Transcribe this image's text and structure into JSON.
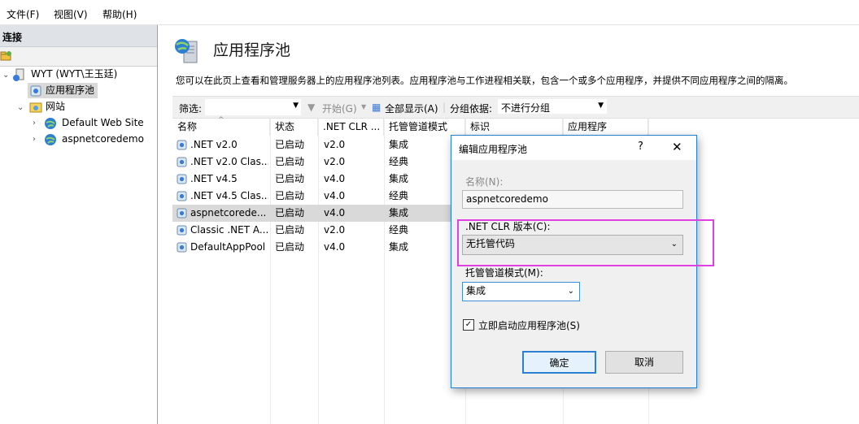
{
  "menu": [
    "文件(F)",
    "视图(V)",
    "帮助(H)"
  ],
  "connections": {
    "header": "连接",
    "tree": {
      "server": "WYT (WYT\\王玉廷)",
      "app_pools": "应用程序池",
      "sites": "网站",
      "site_items": [
        "Default Web Site",
        "aspnetcoredemo"
      ]
    }
  },
  "page": {
    "title": "应用程序池",
    "description": "您可以在此页上查看和管理服务器上的应用程序池列表。应用程序池与工作进程相关联，包含一个或多个应用程序，并提供不同应用程序之间的隔离。"
  },
  "filter_bar": {
    "filter_label": "筛选:",
    "filter_value": "",
    "start_label": "开始(G)",
    "show_all_label": "全部显示(A)",
    "group_label": "分组依据:",
    "group_value": "不进行分组"
  },
  "table": {
    "columns": [
      "名称",
      "状态",
      ".NET CLR ...",
      "托管管道模式",
      "标识",
      "应用程序"
    ],
    "rows": [
      {
        "name": ".NET v2.0",
        "status": "已启动",
        "clr": "v2.0",
        "pipeline": "集成"
      },
      {
        "name": ".NET v2.0 Clas...",
        "status": "已启动",
        "clr": "v2.0",
        "pipeline": "经典"
      },
      {
        "name": ".NET v4.5",
        "status": "已启动",
        "clr": "v4.0",
        "pipeline": "集成"
      },
      {
        "name": ".NET v4.5 Clas...",
        "status": "已启动",
        "clr": "v4.0",
        "pipeline": "经典"
      },
      {
        "name": "aspnetcorede...",
        "status": "已启动",
        "clr": "v4.0",
        "pipeline": "集成"
      },
      {
        "name": "Classic .NET A...",
        "status": "已启动",
        "clr": "v2.0",
        "pipeline": "经典"
      },
      {
        "name": "DefaultAppPool",
        "status": "已启动",
        "clr": "v4.0",
        "pipeline": "集成"
      }
    ],
    "selected_index": 4
  },
  "dialog": {
    "title": "编辑应用程序池",
    "help": "?",
    "close": "✕",
    "name_label": "名称(N):",
    "name_value": "aspnetcoredemo",
    "clr_label": ".NET CLR 版本(C):",
    "clr_value": "无托管代码",
    "pipeline_label": "托管管道模式(M):",
    "pipeline_value": "集成",
    "autostart_label": "立即启动应用程序池(S)",
    "autostart_checked": true,
    "ok": "确定",
    "cancel": "取消"
  },
  "colors": {
    "accent_border": "#1e7fd6",
    "highlight": "#e040e0",
    "selection": "#d9d9d9"
  }
}
